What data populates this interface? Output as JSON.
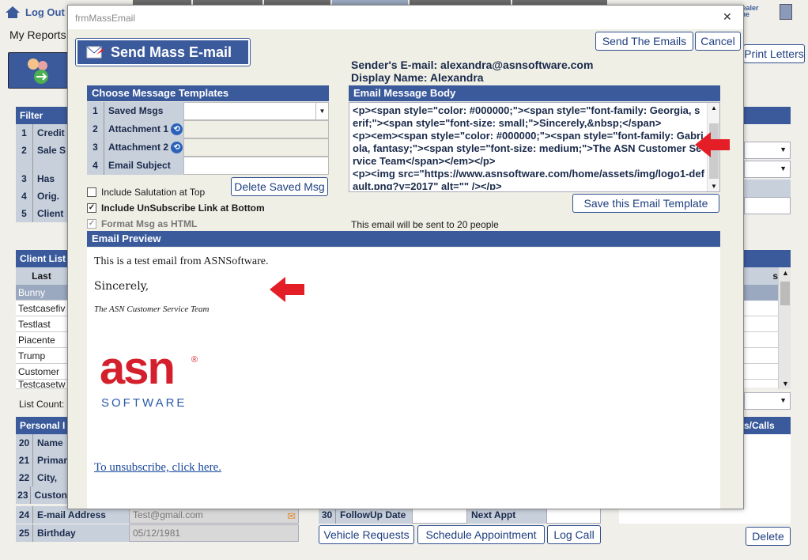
{
  "app": {
    "logout_label": "Log Out",
    "my_reports_label": "My Reports",
    "print_letters_label": "Print Letters",
    "dealer_label": "Dealer\none",
    "filter_header": "Filter Clien",
    "filter_rows": [
      {
        "num": "1",
        "label": "Credit"
      },
      {
        "num": "2",
        "label": "Sale S"
      },
      {
        "num": "3",
        "label": "Has Er"
      },
      {
        "num": "4",
        "label": "Orig. S"
      },
      {
        "num": "5",
        "label": "Client"
      }
    ],
    "client_list_header": "Client List",
    "client_list_col": "Last",
    "client_list_col_right": "s",
    "client_list_rows": [
      "Bunny",
      "Testcasefiv",
      "Testlast",
      "Piacente",
      "Trump",
      "Customer",
      "Testcasetw"
    ],
    "list_count_label": "List Count:",
    "personal_header": "Personal I",
    "calls_header": "s/Calls",
    "personal_rows": [
      {
        "num": "20",
        "label": "Name"
      },
      {
        "num": "21",
        "label": "Primar"
      },
      {
        "num": "22",
        "label": "City, St"
      },
      {
        "num": "23",
        "label": "Custon"
      },
      {
        "num": "24",
        "label": "E-mail Address",
        "value": "Test@gmail.com"
      },
      {
        "num": "25",
        "label": "Birthday",
        "value": "05/12/1981"
      }
    ],
    "followup_num": "30",
    "followup_label": "FollowUp Date",
    "next_appt_label": "Next Appt",
    "vehicle_requests_label": "Vehicle Requests",
    "schedule_appointment_label": "Schedule Appointment",
    "log_call_label": "Log Call",
    "delete_label": "Delete"
  },
  "modal": {
    "window_title": "frmMassEmail",
    "close_glyph": "✕",
    "title": "Send Mass E-mail",
    "send_button": "Send The Emails",
    "cancel_button": "Cancel",
    "sender_email": "Sender's E-mail: alexandra@asnsoftware.com",
    "display_name": "Display Name: Alexandra",
    "templates_header": "Choose Message Templates",
    "template_rows": [
      {
        "num": "1",
        "label": "Saved Msgs",
        "icon": ""
      },
      {
        "num": "2",
        "label": "Attachment 1",
        "icon": "attach-icon"
      },
      {
        "num": "3",
        "label": "Attachment 2",
        "icon": "attach-icon"
      },
      {
        "num": "4",
        "label": "Email Subject",
        "icon": ""
      }
    ],
    "delete_saved_button": "Delete Saved Msg",
    "include_salutation": "Include Salutation at Top",
    "include_unsubscribe": "Include UnSubscribe Link at Bottom",
    "format_html": "Format Msg as HTML",
    "body_header": "Email Message Body",
    "body_html": "<p><span style=\"color: #000000;\"><span style=\"font-family: Georgia, serif;\"><span style=\"font-size: small;\">Sincerely,&nbsp;</span>\n<p><em><span style=\"color: #000000;\"><span style=\"font-family: Gabriola, fantasy;\"><span style=\"font-size: medium;\">The ASN Customer Service Team</span></em></p>\n<p><img src=\"https://www.asnsoftware.com/home/assets/img/logo1-default.png?y=2017\" alt=\"\" /></p>",
    "save_template_button": "Save this Email Template",
    "recipients_note": "This email will be sent to 20 people",
    "preview_header": "Email Preview",
    "preview_line1": "This is a test email from ASNSoftware.",
    "preview_line2": "Sincerely,",
    "preview_signature": "The ASN Customer Service Team",
    "logo_text": "asn",
    "logo_registered": "®",
    "logo_sub": "SOFTWARE",
    "unsubscribe_link": "To unsubscribe, click here."
  },
  "colors": {
    "header_blue": "#3a5a9c",
    "arrow_red": "#e41e26",
    "logo_red": "#d4202c",
    "logo_blue": "#2a5aa8"
  }
}
